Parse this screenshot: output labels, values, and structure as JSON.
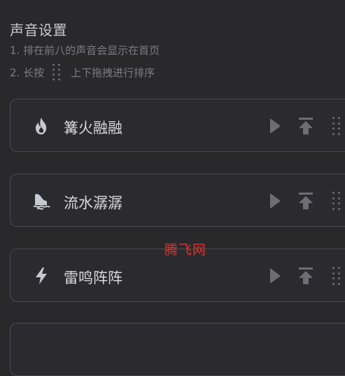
{
  "header": {
    "title": "声音设置",
    "hint1": "1. 排在前八的声音会显示在首页",
    "hint2_prefix": "2. 长按",
    "hint2_suffix": "上下拖拽进行排序"
  },
  "sounds": [
    {
      "name": "篝火融融",
      "icon": "flame-icon"
    },
    {
      "name": "流水潺潺",
      "icon": "water-icon"
    },
    {
      "name": "雷鸣阵阵",
      "icon": "lightning-icon"
    }
  ],
  "actions": {
    "play": "play-icon",
    "pin_top": "pin-to-top-icon",
    "drag": "drag-handle-icon"
  },
  "watermark": "腾飞网",
  "colors": {
    "background": "#29292c",
    "card_border": "#4a4a50",
    "icon": "#c8c8d0",
    "muted": "#6d6d73",
    "watermark": "#e0332e"
  }
}
